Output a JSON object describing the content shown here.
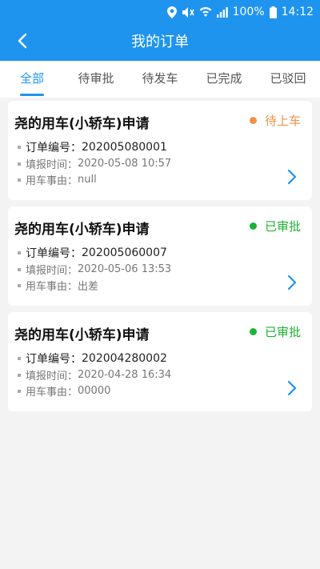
{
  "statusbar": {
    "battery": "100%",
    "time": "14:12"
  },
  "header": {
    "title": "我的订单"
  },
  "tabs": [
    {
      "label": "全部",
      "active": true
    },
    {
      "label": "待审批",
      "active": false
    },
    {
      "label": "待发车",
      "active": false
    },
    {
      "label": "已完成",
      "active": false
    },
    {
      "label": "已驳回",
      "active": false
    }
  ],
  "colors": {
    "primary": "#1e94ef",
    "pending_boarding": "#f0924a",
    "approved": "#1db334"
  },
  "orders": [
    {
      "title": "尧的用车(小轿车)申请",
      "status": "待上车",
      "order_label": "订单编号：",
      "order_no": "202005080001",
      "time_label": "填报时间：",
      "time": "2020-05-08 10:57",
      "reason_label": "用车事由：",
      "reason": "null"
    },
    {
      "title": "尧的用车(小轿车)申请",
      "status": "已审批",
      "order_label": "订单编号：",
      "order_no": "202005060007",
      "time_label": "填报时间：",
      "time": "2020-05-06 13:53",
      "reason_label": "用车事由：",
      "reason": "出差"
    },
    {
      "title": "尧的用车(小轿车)申请",
      "status": "已审批",
      "order_label": "订单编号：",
      "order_no": "202004280002",
      "time_label": "填报时间：",
      "time": "2020-04-28 16:34",
      "reason_label": "用车事由：",
      "reason": "00000"
    }
  ]
}
